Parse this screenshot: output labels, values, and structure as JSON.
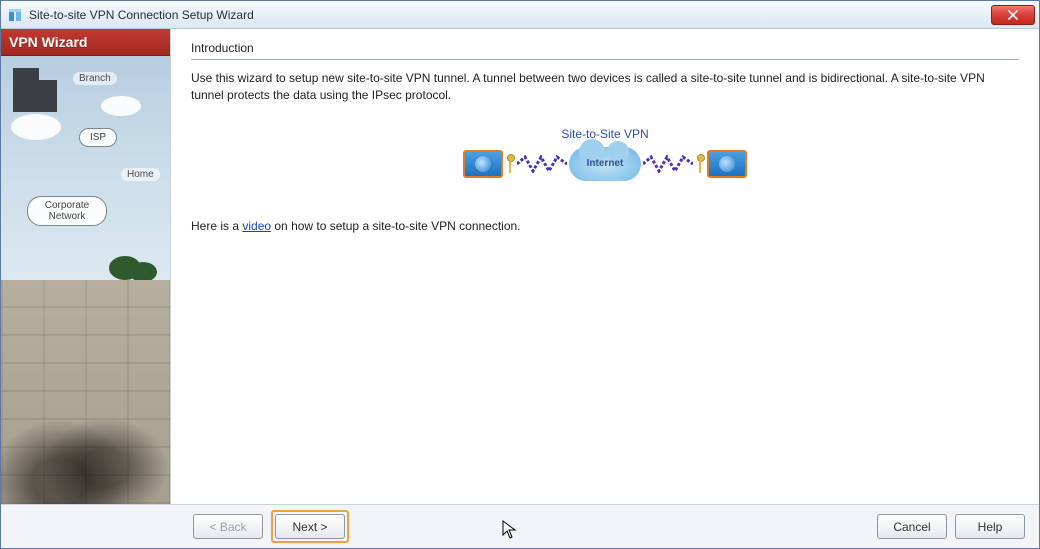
{
  "window": {
    "title": "Site-to-site VPN Connection Setup Wizard"
  },
  "sidebar": {
    "header": "VPN Wizard",
    "labels": {
      "branch": "Branch",
      "isp": "ISP",
      "home": "Home",
      "corporate": "Corporate Network"
    }
  },
  "content": {
    "heading": "Introduction",
    "intro": "Use this wizard to setup new site-to-site VPN tunnel. A tunnel between two devices is called a site-to-site tunnel and is bidirectional. A site-to-site VPN tunnel protects the data using the IPsec protocol.",
    "diagram_title": "Site-to-Site VPN",
    "internet_label": "Internet",
    "video_prefix": "Here is a ",
    "video_link": "video",
    "video_suffix": " on how to setup a site-to-site VPN connection."
  },
  "buttons": {
    "back": "< Back",
    "next": "Next >",
    "cancel": "Cancel",
    "help": "Help"
  }
}
